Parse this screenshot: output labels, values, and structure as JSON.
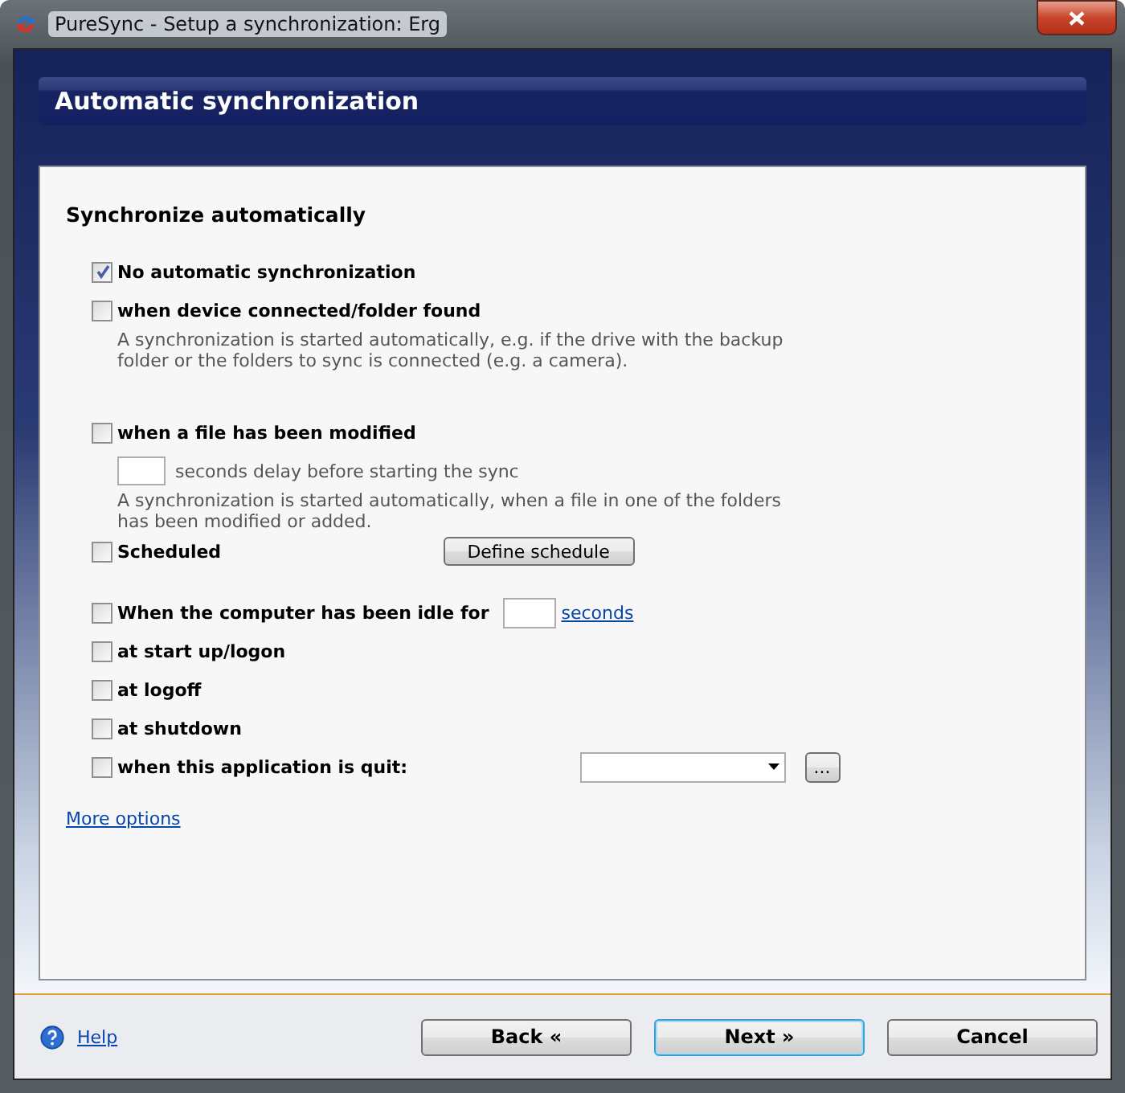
{
  "window": {
    "title": "PureSync - Setup a synchronization: Erg"
  },
  "header": {
    "title": "Automatic synchronization"
  },
  "section": {
    "title": "Synchronize automatically"
  },
  "options": [
    {
      "kind": "plain",
      "label": "No automatic synchronization",
      "checked": true
    },
    {
      "kind": "described",
      "label": "when device connected/folder found",
      "checked": false,
      "description": "A synchronization is started automatically, e.g. if the drive with the backup folder or the folders to sync is connected (e.g. a camera)."
    },
    {
      "kind": "delay",
      "label": "when a file has been modified",
      "checked": false,
      "field_label": "seconds delay before starting the sync",
      "description": "A synchronization is started automatically, when a file in one of the folders has been modified or added."
    },
    {
      "kind": "schedule",
      "label": "Scheduled",
      "checked": false,
      "button": "Define schedule"
    },
    {
      "kind": "idle",
      "label": "When the computer has been idle for",
      "checked": false,
      "link": "seconds"
    },
    {
      "kind": "plain",
      "label": "at start up/logon",
      "checked": false
    },
    {
      "kind": "plain",
      "label": "at logoff",
      "checked": false
    },
    {
      "kind": "plain",
      "label": "at shutdown",
      "checked": false
    },
    {
      "kind": "quit",
      "label": "when this application is quit:",
      "checked": false,
      "button": "..."
    }
  ],
  "more_link": "More options",
  "footer": {
    "help": "Help",
    "buttons": [
      {
        "label": "Back «",
        "default": false
      },
      {
        "label": "Next »",
        "default": true
      },
      {
        "label": "Cancel",
        "default": false
      }
    ]
  }
}
